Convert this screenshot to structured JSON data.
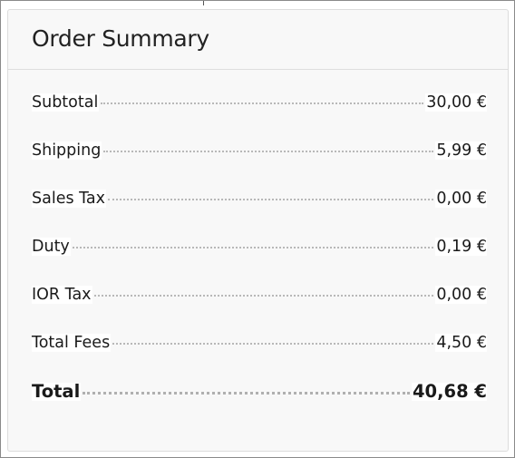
{
  "order_summary": {
    "title": "Order Summary",
    "rows": [
      {
        "label": "Subtotal",
        "value": "30,00 €"
      },
      {
        "label": "Shipping",
        "value": "5,99 €"
      },
      {
        "label": "Sales Tax",
        "value": "0,00 €"
      },
      {
        "label": "Duty",
        "value": "0,19 €"
      },
      {
        "label": "IOR Tax",
        "value": "0,00 €"
      },
      {
        "label": "Total Fees",
        "value": "4,50 €"
      }
    ],
    "total": {
      "label": "Total",
      "value": "40,68 €"
    }
  }
}
